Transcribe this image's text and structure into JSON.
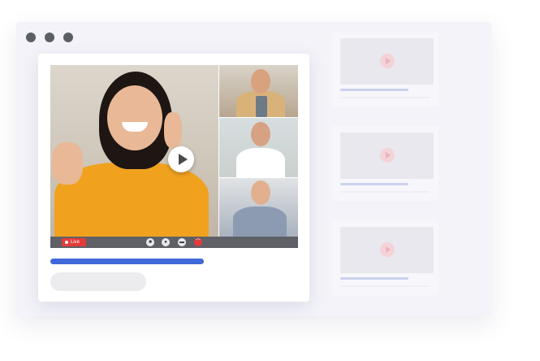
{
  "window": {
    "controls": [
      "close",
      "minimize",
      "maximize"
    ]
  },
  "player": {
    "live_label": "Live",
    "progress": 0.62,
    "controls": [
      {
        "name": "camera-icon",
        "glyph": "■"
      },
      {
        "name": "microphone-icon",
        "glyph": "●"
      },
      {
        "name": "chat-icon",
        "glyph": "▬"
      },
      {
        "name": "end-call-icon",
        "glyph": "⌒"
      }
    ]
  },
  "colors": {
    "accent": "#3f68d9",
    "live": "#e23b3b",
    "background": "#f3f3f9"
  },
  "sidebar": {
    "videos": [
      {
        "thumbnail": "video-thumbnail"
      },
      {
        "thumbnail": "video-thumbnail"
      },
      {
        "thumbnail": "video-thumbnail"
      }
    ]
  }
}
